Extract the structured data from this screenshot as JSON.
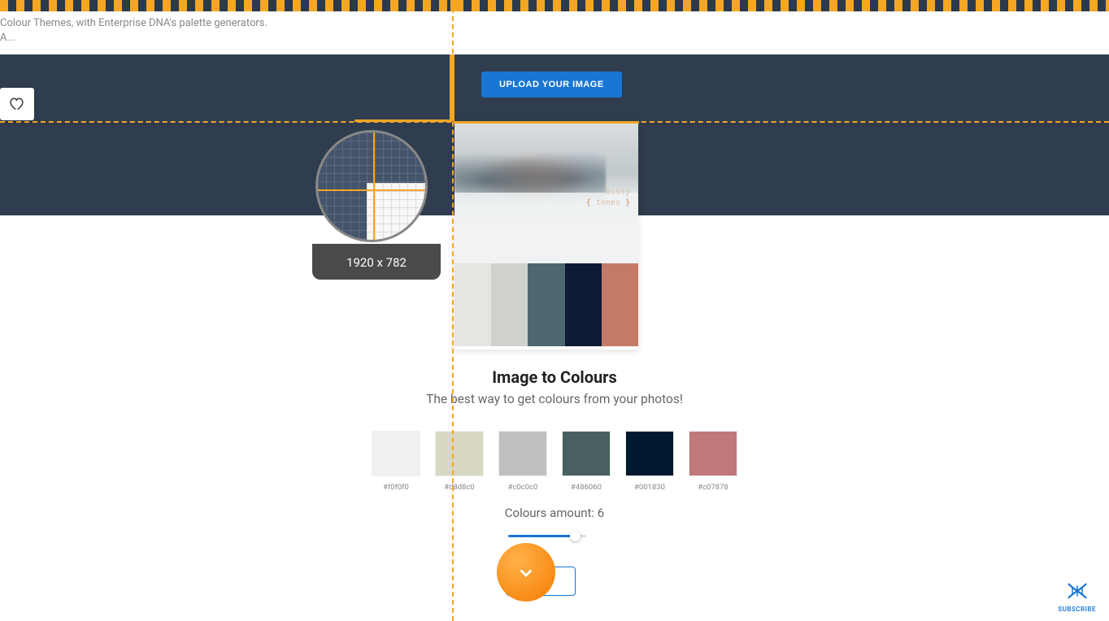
{
  "header": {
    "line1": "Colour Themes, with Enterprise DNA's palette generators.",
    "line2": "A..."
  },
  "upload_button_label": "UPLOAD YOUR IMAGE",
  "magnifier": {
    "dimensions": "1920 x 782"
  },
  "preview": {
    "overlay_line1": "misty",
    "overlay_line2_braces_open": "{",
    "overlay_line2_text": " tones ",
    "overlay_line2_braces_close": "}",
    "palette": [
      "#e6e6e0",
      "#cfd2cc",
      "#4e6670",
      "#0f1b36",
      "#c47a66"
    ]
  },
  "title": "Image to Colours",
  "subtitle": "The best way to get colours from your photos!",
  "swatches": [
    {
      "hex": "#f0f0f0",
      "color": "#f0f0f0"
    },
    {
      "hex": "#d8d8c0",
      "color": "#d8d8c0"
    },
    {
      "hex": "#c0c0c0",
      "color": "#c0c0c0"
    },
    {
      "hex": "#486060",
      "color": "#486060"
    },
    {
      "hex": "#001830",
      "color": "#001830"
    },
    {
      "hex": "#c07878",
      "color": "#c07878"
    }
  ],
  "amount_label": "Colours amount: ",
  "amount_value": "6",
  "subscribe_label": "SUBSCRIBE"
}
